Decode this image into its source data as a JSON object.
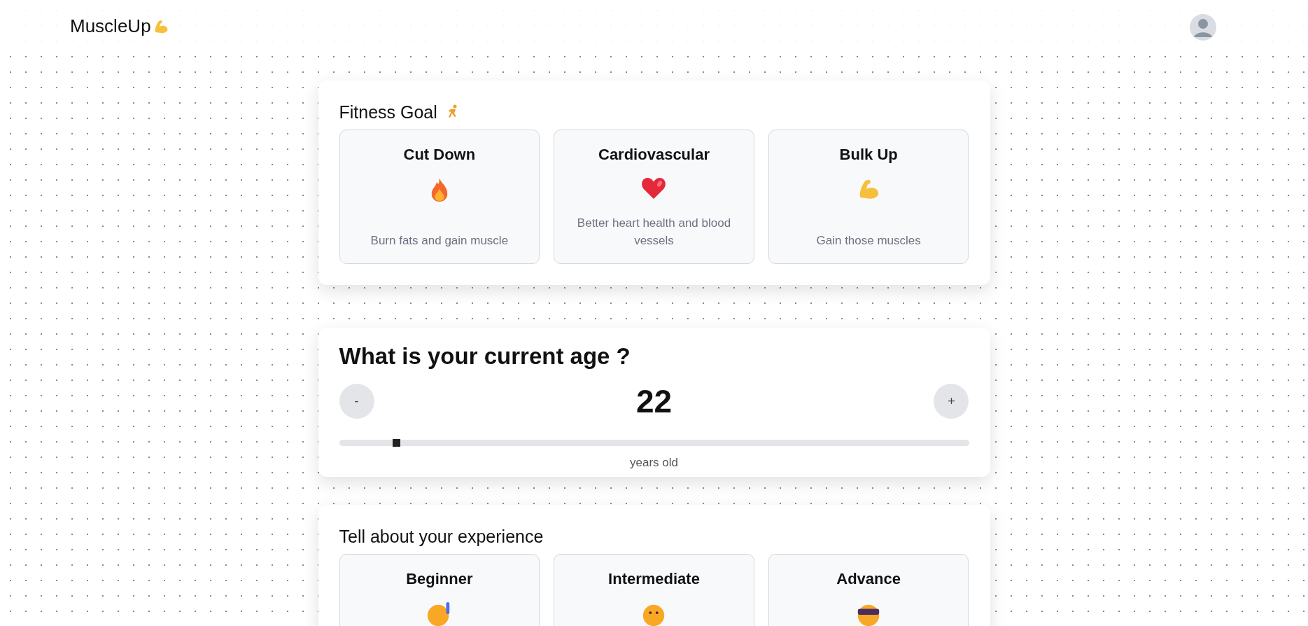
{
  "header": {
    "logo": "MuscleUp"
  },
  "fitness_goal": {
    "title": "Fitness Goal",
    "options": [
      {
        "title": "Cut Down",
        "description": "Burn fats and gain muscle",
        "kind": "fire"
      },
      {
        "title": "Cardiovascular",
        "description": "Better heart health and blood vessels",
        "kind": "heart"
      },
      {
        "title": "Bulk Up",
        "description": "Gain those muscles",
        "kind": "arm"
      }
    ]
  },
  "age": {
    "title": "What is your current age ?",
    "decrement": "-",
    "increment": "+",
    "value": "22",
    "unit": "years old",
    "level": 0.09
  },
  "experience": {
    "title": "Tell about your experience",
    "options": [
      {
        "title": "Beginner",
        "kind": "nerd"
      },
      {
        "title": "Intermediate",
        "kind": "face"
      },
      {
        "title": "Advance",
        "kind": "cool"
      }
    ]
  }
}
